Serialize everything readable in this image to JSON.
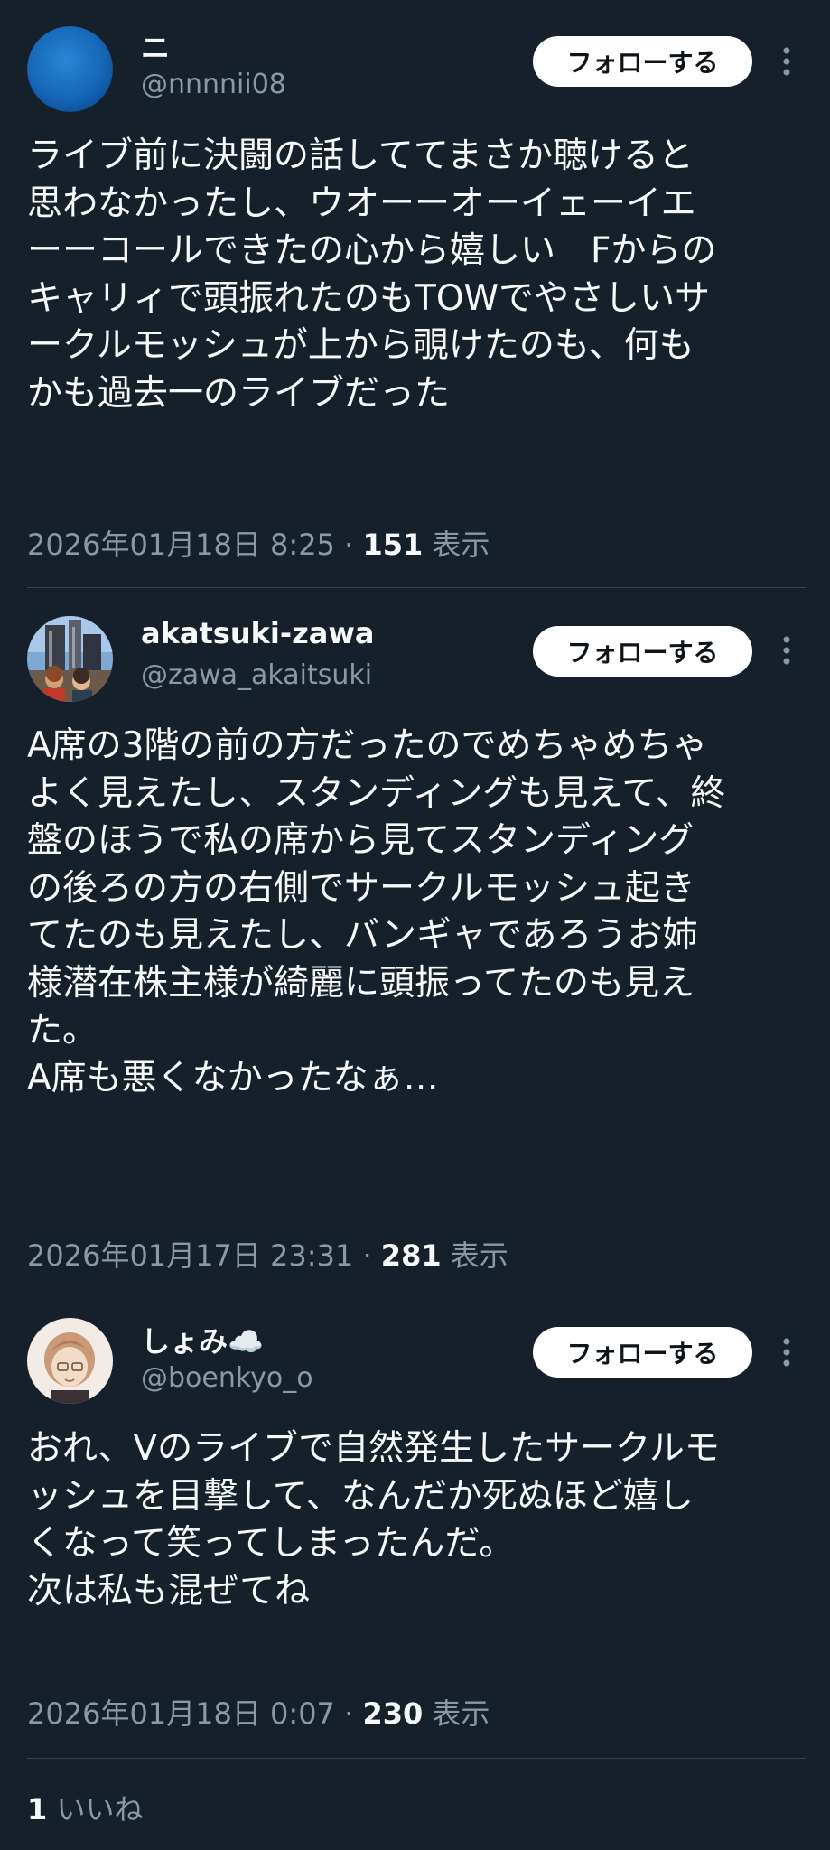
{
  "posts": [
    {
      "name": "ニ",
      "handle": "@nnnnii08",
      "follow_label": "フォローする",
      "text_lines": [
        "ライブ前に決闘の話しててまさか聴けると",
        "思わなかったし、ウオーーオーイェーイエ",
        "ーーコールできたの心から嬉しい　Fからの",
        "キャリィで頭振れたのもTOWでやさしいサ",
        "ークルモッシュが上から覗けたのも、何も",
        "かも過去一のライブだった"
      ],
      "date": "2026年01月18日 8:25 · ",
      "views": "151",
      "views_label": " 表示"
    },
    {
      "name": "akatsuki-zawa",
      "handle": "@zawa_akaitsuki",
      "follow_label": "フォローする",
      "text_lines": [
        "A席の3階の前の方だったのでめちゃめちゃ",
        "よく見えたし、スタンディングも見えて、終",
        "盤のほうで私の席から見てスタンディング",
        "の後ろの方の右側でサークルモッシュ起き",
        "てたのも見えたし、バンギャであろうお姉",
        "様潜在株主様が綺麗に頭振ってたのも見え",
        "た。",
        "A席も悪くなかったなぁ…"
      ],
      "date": "2026年01月17日 23:31 · ",
      "views": "281",
      "views_label": " 表示"
    },
    {
      "name": "しょみ☁️",
      "handle": "@boenkyo_o",
      "follow_label": "フォローする",
      "text_lines": [
        "おれ、Vのライブで自然発生したサークルモ",
        "ッシュを目撃して、なんだか死ぬほど嬉し",
        "くなって笑ってしまったんだ。",
        "次は私も混ぜてね"
      ],
      "date": "2026年01月18日 0:07 · ",
      "views": "230",
      "views_label": " 表示"
    }
  ],
  "likes": {
    "count": "1",
    "label": " いいね"
  },
  "colors": {
    "background": "#15202b",
    "text": "#f7f9f9",
    "secondary": "#8b98a5",
    "divider": "#38444d",
    "button_bg": "#ffffff",
    "button_text": "#0f1419"
  },
  "icons": {
    "more": "more-vertical-icon"
  }
}
